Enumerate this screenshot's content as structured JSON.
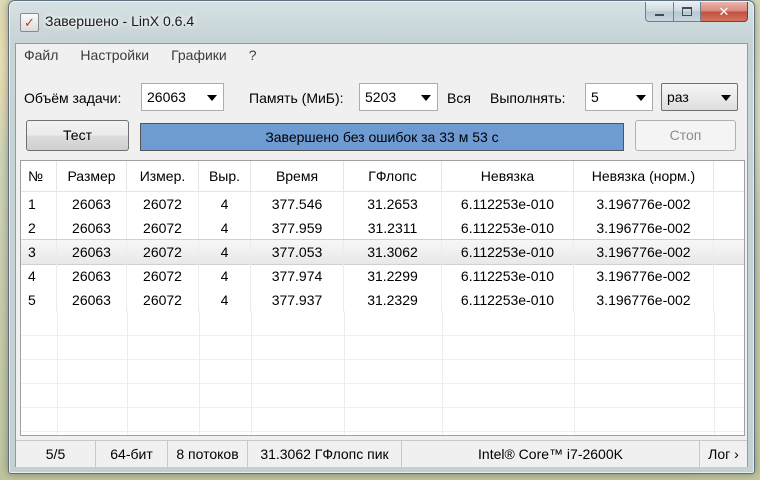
{
  "window": {
    "title": "Завершено - LinX 0.6.4",
    "icon": "checkmark-app-icon"
  },
  "menu": [
    "Файл",
    "Настройки",
    "Графики",
    "?"
  ],
  "params": {
    "task_size_label": "Объём задачи:",
    "task_size_value": "26063",
    "memory_label": "Память (МиБ):",
    "memory_value": "5203",
    "all_label": "Вся",
    "run_label": "Выполнять:",
    "run_value": "5",
    "run_unit": "раз"
  },
  "actions": {
    "test_button": "Тест",
    "progress_text": "Завершено без ошибок за 33 м 53 с",
    "progress_fraction": 1.0,
    "stop_button": "Стоп"
  },
  "table": {
    "columns": [
      "№",
      "Размер",
      "Измер.",
      "Выр.",
      "Время",
      "ГФлопс",
      "Невязка",
      "Невязка (норм.)"
    ],
    "rows": [
      [
        "1",
        "26063",
        "26072",
        "4",
        "377.546",
        "31.2653",
        "6.112253e-010",
        "3.196776e-002"
      ],
      [
        "2",
        "26063",
        "26072",
        "4",
        "377.959",
        "31.2311",
        "6.112253e-010",
        "3.196776e-002"
      ],
      [
        "3",
        "26063",
        "26072",
        "4",
        "377.053",
        "31.3062",
        "6.112253e-010",
        "3.196776e-002"
      ],
      [
        "4",
        "26063",
        "26072",
        "4",
        "377.974",
        "31.2299",
        "6.112253e-010",
        "3.196776e-002"
      ],
      [
        "5",
        "26063",
        "26072",
        "4",
        "377.937",
        "31.2329",
        "6.112253e-010",
        "3.196776e-002"
      ]
    ],
    "selected_row": 3
  },
  "status": {
    "progress_count": "5/5",
    "bits": "64-бит",
    "threads": "8 потоков",
    "peak": "31.3062 ГФлопс пик",
    "cpu": "Intel® Core™ i7-2600K",
    "log": "Лог ›"
  },
  "colors": {
    "progress_fill": "#6f9bd3",
    "close_button": "#c24f3f"
  }
}
